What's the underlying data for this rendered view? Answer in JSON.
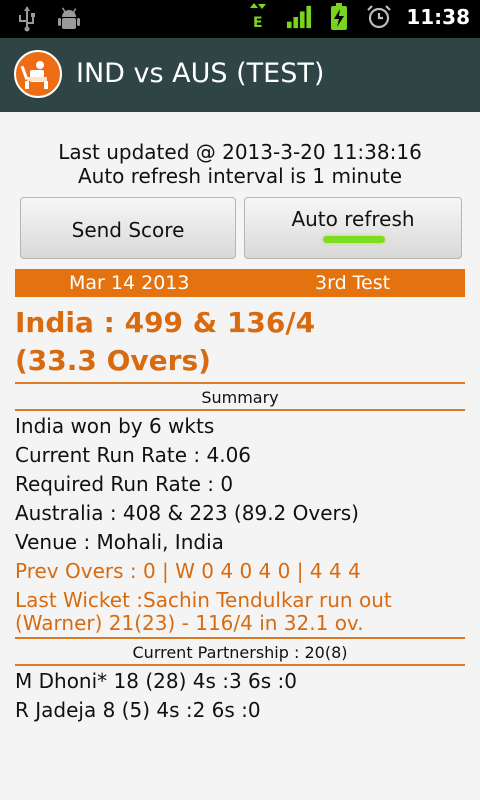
{
  "status_bar": {
    "time": "11:38",
    "network_label": "E",
    "left_icons": [
      "usb-icon",
      "android-debug-icon"
    ],
    "right_icons": [
      "data-transfer-icon",
      "signal-icon",
      "battery-charging-icon",
      "alarm-clock-icon"
    ]
  },
  "app": {
    "title": "IND vs AUS (TEST)"
  },
  "info": {
    "last_updated": "Last updated @ 2013-3-20 11:38:16",
    "refresh_interval": "Auto refresh interval is 1 minute"
  },
  "buttons": {
    "send_score": "Send Score",
    "auto_refresh": "Auto refresh",
    "auto_refresh_on": true
  },
  "match": {
    "date": "Mar 14 2013",
    "test_name": "3rd Test",
    "score_line1": "India : 499 & 136/4",
    "score_line2": "(33.3 Overs)"
  },
  "summary": {
    "heading": "Summary",
    "result": "India won by 6 wkts",
    "current_run_rate": "Current Run Rate : 4.06",
    "required_run_rate": "Required Run Rate : 0",
    "opponent_score": "Australia : 408 & 223 (89.2 Overs)",
    "venue": "Venue : Mohali, India",
    "prev_overs": "Prev Overs :  0 | W 0 4 0 4 0 | 4 4 4",
    "last_wicket": "Last Wicket :Sachin Tendulkar run out (Warner) 21(23) - 116/4 in 32.1 ov."
  },
  "partnership": {
    "heading": "Current Partnership : 20(8)",
    "batsman1": "M Dhoni* 18 (28) 4s :3 6s :0",
    "batsman2": "R Jadeja 8 (5) 4s :2 6s :0"
  },
  "colors": {
    "accent_orange": "#e4720f",
    "score_orange": "#d86b10",
    "titlebar": "#2f4545",
    "indicator_green": "#7fdc20"
  }
}
